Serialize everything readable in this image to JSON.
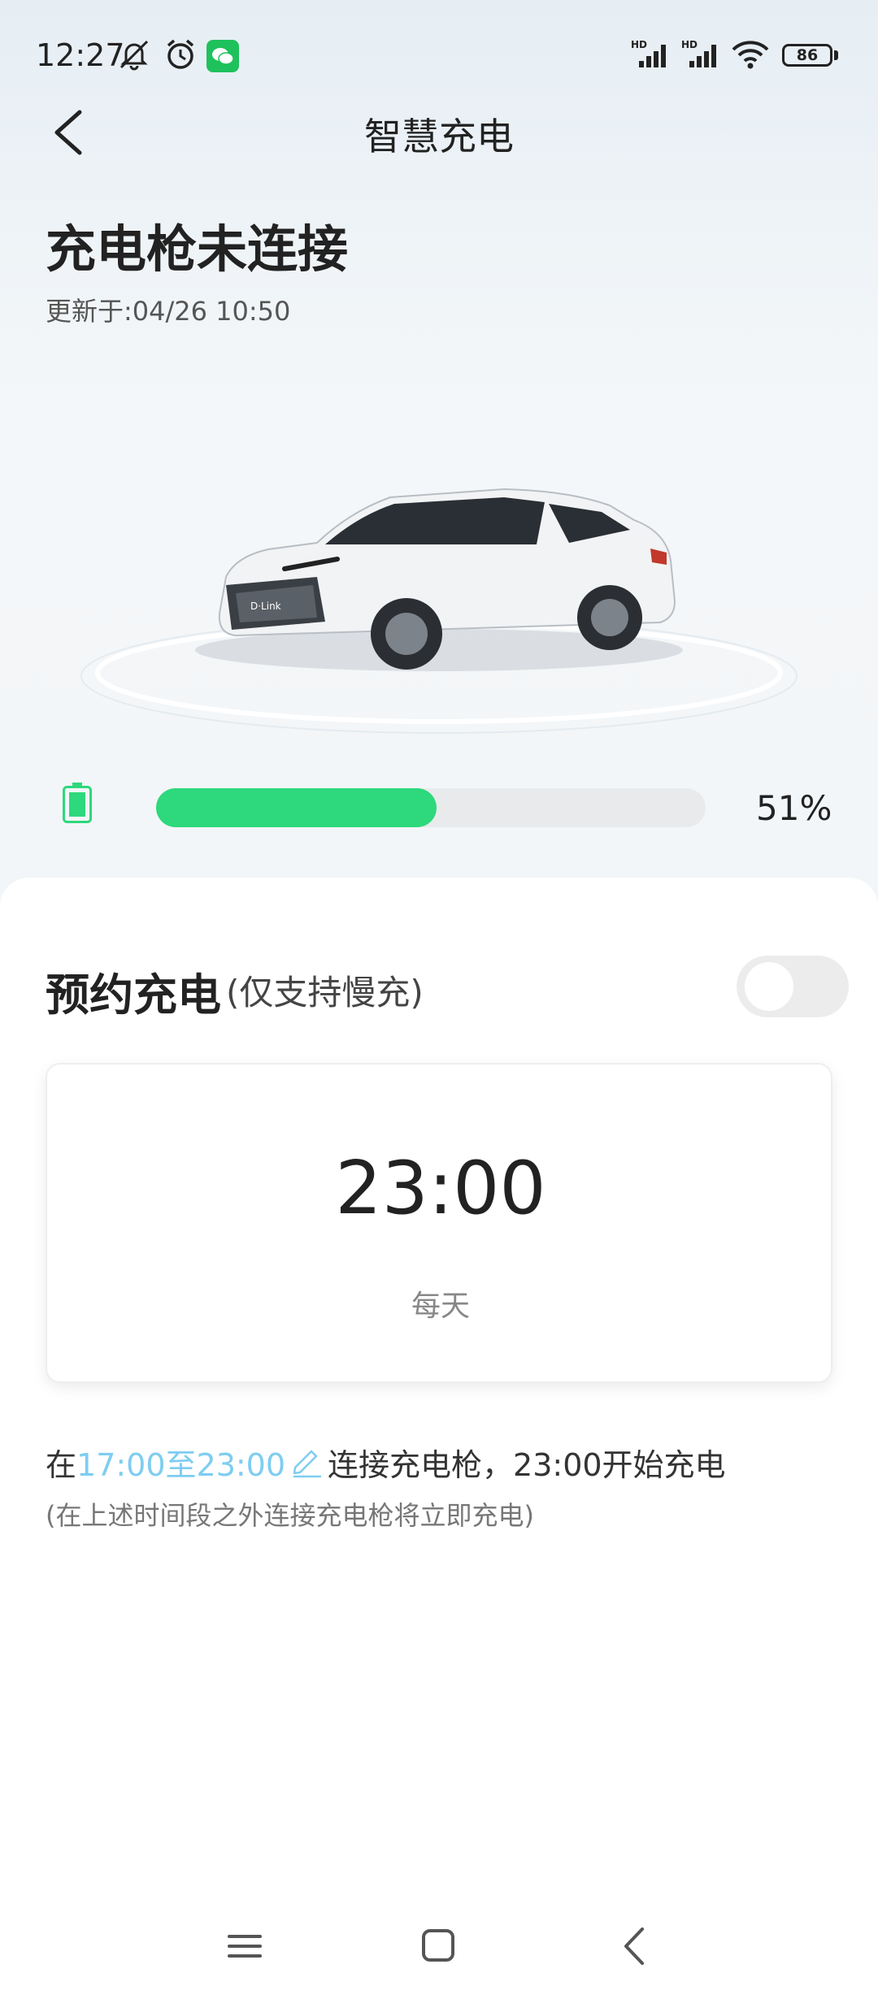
{
  "status_bar": {
    "time": "12:27",
    "battery_level": "86",
    "icons": [
      "mute-bell-icon",
      "alarm-icon",
      "wechat-icon",
      "signal-hd-icon",
      "signal-hd-icon",
      "wifi-icon"
    ]
  },
  "header": {
    "title": "智慧充电",
    "back_icon": "chevron-left-icon"
  },
  "charge_status": {
    "title": "充电枪未连接",
    "updated": "更新于:04/26 10:50"
  },
  "battery": {
    "percent_label": "51%",
    "percent_value": 0.51,
    "fill_color": "#2ed87c"
  },
  "schedule": {
    "title": "预约充电",
    "subtitle": "(仅支持慢充)",
    "toggle_on": false,
    "time": "23:00",
    "repeat": "每天",
    "window_prefix": "在",
    "window_range": "17:00至23:00",
    "window_suffix": "连接充电枪，23:00开始充电",
    "note": "(在上述时间段之外连接充电枪将立即充电)",
    "accent_color": "#7ecdf0"
  },
  "nav_bar": {
    "icons": [
      "menu-icon",
      "home-icon",
      "back-icon"
    ]
  }
}
